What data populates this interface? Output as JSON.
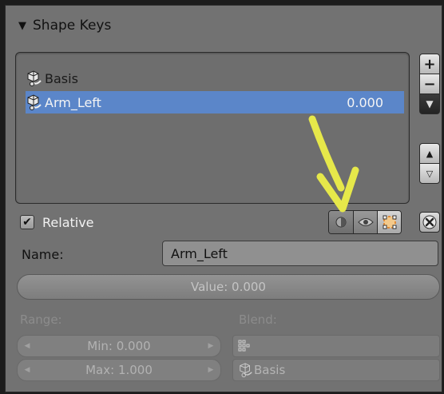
{
  "panel": {
    "title": "Shape Keys",
    "collapse_icon": "triangle-down-icon"
  },
  "shape_keys": [
    {
      "name": "Basis",
      "value": "",
      "selected": false
    },
    {
      "name": "Arm_Left",
      "value": "0.000",
      "selected": true
    }
  ],
  "side_buttons": {
    "add": "+",
    "remove": "−",
    "specials": "▼",
    "move_up": "▲",
    "move_down": "▽"
  },
  "relative": {
    "label": "Relative",
    "checked": true
  },
  "toolbar": {
    "shape_only_icon": "pin-icon",
    "edit_mode_icon": "eye-icon",
    "apply_to_cage_icon": "vertex-select-icon",
    "clear_icon": "x-icon"
  },
  "name": {
    "label": "Name:",
    "value": "Arm_Left"
  },
  "value_slider": {
    "text": "Value: 0.000",
    "fraction": 0.0
  },
  "range": {
    "label": "Range:",
    "min": "Min: 0.000",
    "max": "Max: 1.000"
  },
  "blend": {
    "label": "Blend:",
    "vertex_group": "",
    "relative_key": "Basis"
  },
  "colors": {
    "selection": "#5b86c9",
    "annotation_arrow": "#e6e84a"
  }
}
